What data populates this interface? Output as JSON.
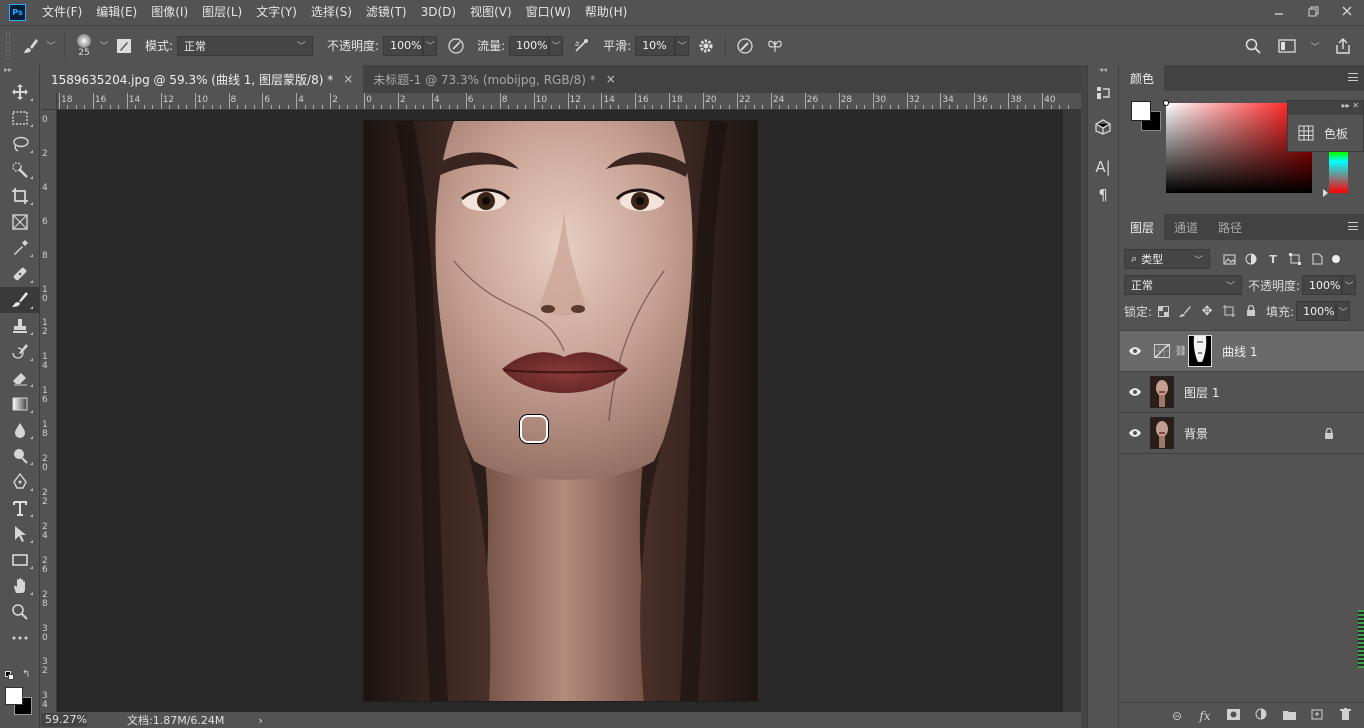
{
  "app": {
    "logo": "Ps"
  },
  "menu": [
    "文件(F)",
    "编辑(E)",
    "图像(I)",
    "图层(L)",
    "文字(Y)",
    "选择(S)",
    "滤镜(T)",
    "3D(D)",
    "视图(V)",
    "窗口(W)",
    "帮助(H)"
  ],
  "options": {
    "brush_size": "25",
    "mode_label": "模式:",
    "mode_value": "正常",
    "opacity_label": "不透明度:",
    "opacity_value": "100%",
    "flow_label": "流量:",
    "flow_value": "100%",
    "smooth_label": "平滑:",
    "smooth_value": "10%"
  },
  "tabs": [
    {
      "label": "1589635204.jpg @ 59.3% (曲线 1, 图层蒙版/8) *",
      "close": "×"
    },
    {
      "label": "未标题-1 @ 73.3% (mobijpg, RGB/8) *",
      "close": "×"
    }
  ],
  "ruler_h": [
    "18",
    "16",
    "14",
    "12",
    "10",
    "8",
    "6",
    "4",
    "2",
    "0",
    "2",
    "4",
    "6",
    "8",
    "10",
    "12",
    "14",
    "16",
    "18",
    "20",
    "22",
    "24",
    "26",
    "28",
    "30",
    "32",
    "34",
    "36",
    "38",
    "40"
  ],
  "ruler_v": [
    "0",
    "2",
    "4",
    "6",
    "8",
    "1 0",
    "1 2",
    "1 4",
    "1 6",
    "1 8",
    "2 0",
    "2 2",
    "2 4",
    "2 6",
    "2 8",
    "3 0",
    "3 2",
    "3 4"
  ],
  "status": {
    "zoom": "59.27%",
    "doc": "文档:1.87M/6.24M",
    "arrow": "›"
  },
  "color_panel": {
    "tab": "颜色",
    "fg": "#ffffff",
    "bg": "#000000"
  },
  "swatch_popup": {
    "label": "色板"
  },
  "layers_panel": {
    "tabs": [
      "图层",
      "通道",
      "路径"
    ],
    "filter_label": "类型",
    "blend_mode": "正常",
    "opacity_label": "不透明度:",
    "opacity_value": "100%",
    "lock_label": "锁定:",
    "fill_label": "填充:",
    "fill_value": "100%",
    "layers": [
      {
        "name": "曲线 1",
        "selected": true
      },
      {
        "name": "图层 1",
        "selected": false
      },
      {
        "name": "背景",
        "selected": false
      }
    ],
    "footer_icons": [
      "link-icon",
      "fx-icon",
      "mask-icon",
      "adjustment-icon",
      "group-icon",
      "new-layer-icon",
      "trash-icon"
    ],
    "fx_label": "fx"
  },
  "colors": {
    "accent": "#31a8ff",
    "ui_bg": "#535353",
    "canvas_bg": "#282828"
  }
}
